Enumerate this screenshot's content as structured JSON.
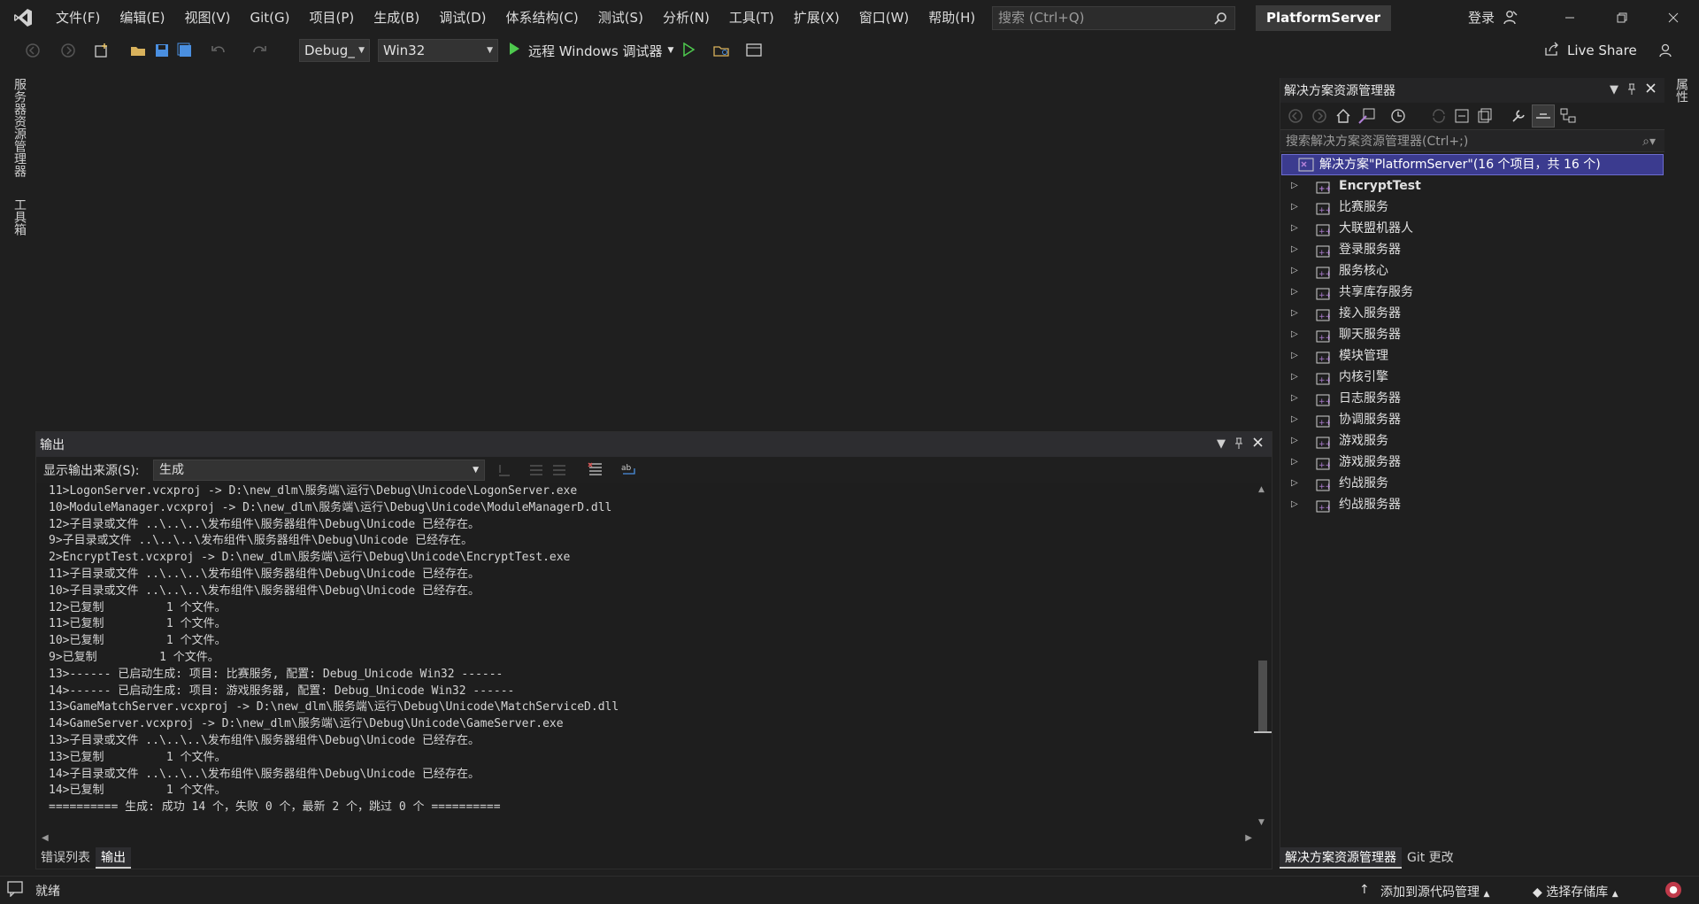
{
  "menu": [
    "文件(F)",
    "编辑(E)",
    "视图(V)",
    "Git(G)",
    "项目(P)",
    "生成(B)",
    "调试(D)",
    "体系结构(C)",
    "测试(S)",
    "分析(N)",
    "工具(T)",
    "扩展(X)",
    "窗口(W)",
    "帮助(H)"
  ],
  "search": {
    "placeholder": "搜索 (Ctrl+Q)"
  },
  "solution_title": "PlatformServer",
  "login": "登录",
  "toolbar": {
    "config": "Debug_",
    "platform": "Win32",
    "run_label": "远程 Windows 调试器",
    "live_share": "Live Share"
  },
  "left_tabs": [
    "服务器资源管理器",
    "工具箱"
  ],
  "right_tab": "属性",
  "output": {
    "title": "输出",
    "source_label": "显示输出来源(S):",
    "source_value": "生成",
    "lines": [
      "11>LogonServer.vcxproj -> D:\\new_dlm\\服务端\\运行\\Debug\\Unicode\\LogonServer.exe",
      "10>ModuleManager.vcxproj -> D:\\new_dlm\\服务端\\运行\\Debug\\Unicode\\ModuleManagerD.dll",
      "12>子目录或文件 ..\\..\\..\\发布组件\\服务器组件\\Debug\\Unicode 已经存在。",
      "9>子目录或文件 ..\\..\\..\\发布组件\\服务器组件\\Debug\\Unicode 已经存在。",
      "2>EncryptTest.vcxproj -> D:\\new_dlm\\服务端\\运行\\Debug\\Unicode\\EncryptTest.exe",
      "11>子目录或文件 ..\\..\\..\\发布组件\\服务器组件\\Debug\\Unicode 已经存在。",
      "10>子目录或文件 ..\\..\\..\\发布组件\\服务器组件\\Debug\\Unicode 已经存在。",
      "12>已复制         1 个文件。",
      "11>已复制         1 个文件。",
      "10>已复制         1 个文件。",
      "9>已复制         1 个文件。",
      "13>------ 已启动生成: 项目: 比赛服务, 配置: Debug_Unicode Win32 ------",
      "14>------ 已启动生成: 项目: 游戏服务器, 配置: Debug_Unicode Win32 ------",
      "13>GameMatchServer.vcxproj -> D:\\new_dlm\\服务端\\运行\\Debug\\Unicode\\MatchServiceD.dll",
      "14>GameServer.vcxproj -> D:\\new_dlm\\服务端\\运行\\Debug\\Unicode\\GameServer.exe",
      "13>子目录或文件 ..\\..\\..\\发布组件\\服务器组件\\Debug\\Unicode 已经存在。",
      "13>已复制         1 个文件。",
      "14>子目录或文件 ..\\..\\..\\发布组件\\服务器组件\\Debug\\Unicode 已经存在。",
      "14>已复制         1 个文件。",
      "========== 生成: 成功 14 个，失败 0 个，最新 2 个，跳过 0 个 =========="
    ],
    "tabs": [
      "错误列表",
      "输出"
    ]
  },
  "solution_explorer": {
    "title": "解决方案资源管理器",
    "search_placeholder": "搜索解决方案资源管理器(Ctrl+;)",
    "root": "解决方案\"PlatformServer\"(16 个项目，共 16 个)",
    "projects": [
      "EncryptTest",
      "比赛服务",
      "大联盟机器人",
      "登录服务器",
      "服务核心",
      "共享库存服务",
      "接入服务器",
      "聊天服务器",
      "模块管理",
      "内核引擎",
      "日志服务器",
      "协调服务器",
      "游戏服务",
      "游戏服务器",
      "约战服务",
      "约战服务器"
    ],
    "tabs": [
      "解决方案资源管理器",
      "Git 更改"
    ]
  },
  "status": {
    "ready": "就绪",
    "add_source": "添加到源代码管理",
    "select_repo": "选择存储库"
  },
  "colors": {
    "accent": "#3b3b8f",
    "project_icon": "#b180d7",
    "run_green": "#4ec94e"
  }
}
